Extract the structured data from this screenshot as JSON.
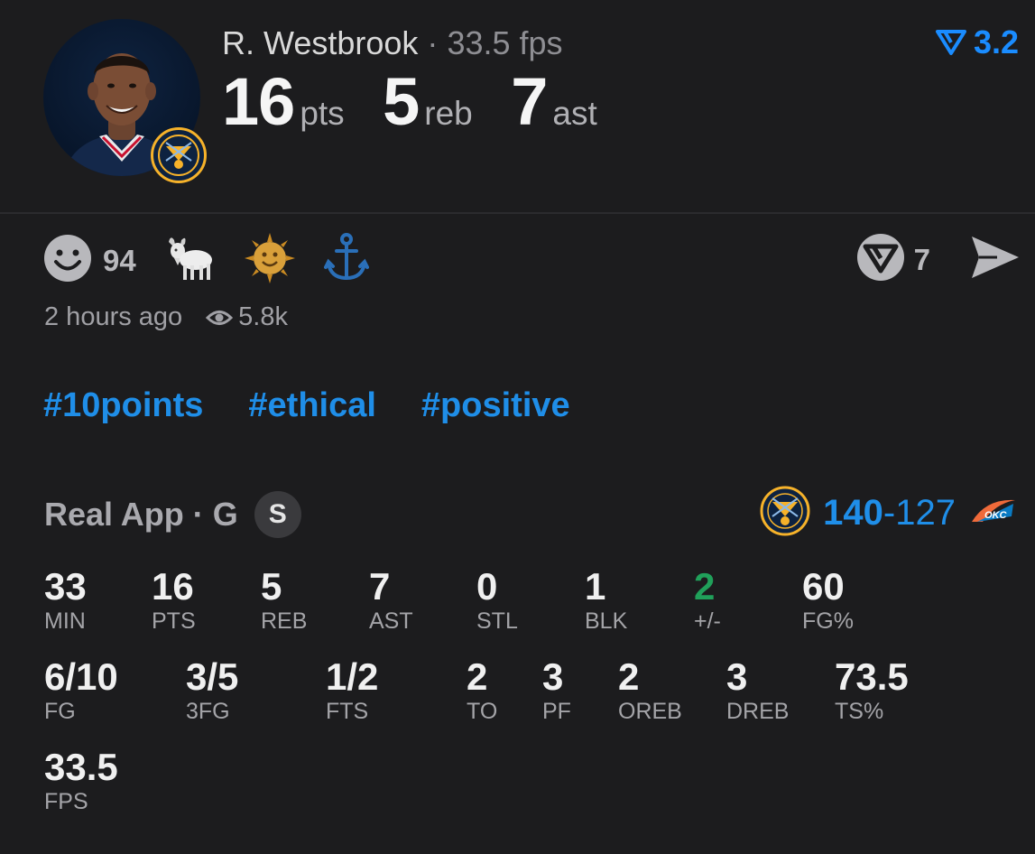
{
  "header": {
    "player_name": "R. Westbrook",
    "separator": "·",
    "fps": "33.5 fps",
    "rating": "3.2",
    "headline": [
      {
        "value": "16",
        "unit": "pts"
      },
      {
        "value": "5",
        "unit": "reb"
      },
      {
        "value": "7",
        "unit": "ast"
      }
    ]
  },
  "reactions": {
    "smiley_count": "94",
    "sub_count": "7",
    "icons": [
      "smiley-icon",
      "goat-icon",
      "sun-icon",
      "anchor-icon"
    ]
  },
  "meta": {
    "time": "2 hours ago",
    "views": "5.8k"
  },
  "tags": [
    "#10points",
    "#ethical",
    "#positive"
  ],
  "game": {
    "source": "Real App",
    "separator": "·",
    "position": "G",
    "badge": "S",
    "score_win": "140",
    "score_sep": "-",
    "score_loss": "127",
    "opponent_logo_text": "OKC"
  },
  "stats": [
    {
      "v": "33",
      "l": "MIN"
    },
    {
      "v": "16",
      "l": "PTS"
    },
    {
      "v": "5",
      "l": "REB"
    },
    {
      "v": "7",
      "l": "AST"
    },
    {
      "v": "0",
      "l": "STL"
    },
    {
      "v": "1",
      "l": "BLK"
    },
    {
      "v": "2",
      "l": "+/-"
    },
    {
      "v": "60",
      "l": "FG%"
    },
    {
      "v": "6/10",
      "l": "FG"
    },
    {
      "v": "3/5",
      "l": "3FG"
    },
    {
      "v": "1/2",
      "l": "FTS"
    },
    {
      "v": "2",
      "l": "TO"
    },
    {
      "v": "3",
      "l": "PF"
    },
    {
      "v": "2",
      "l": "OREB"
    },
    {
      "v": "3",
      "l": "DREB"
    },
    {
      "v": "73.5",
      "l": "TS%"
    },
    {
      "v": "33.5",
      "l": "FPS"
    }
  ],
  "colors": {
    "background": "#1c1c1e",
    "accent_blue": "#1f8ee8",
    "positive_green": "#20a05a",
    "nuggets_gold": "#f6b22a",
    "nuggets_navy": "#0d2240"
  }
}
